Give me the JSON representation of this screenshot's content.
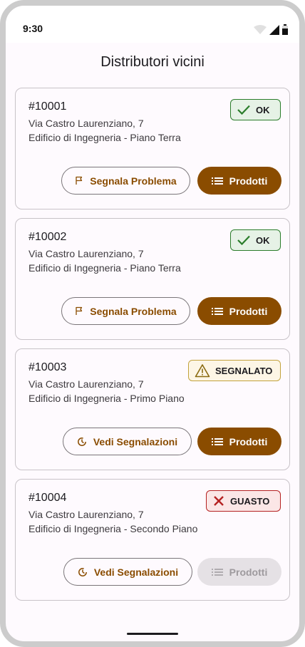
{
  "status_bar": {
    "time": "9:30"
  },
  "header": {
    "title": "Distributori vicini"
  },
  "colors": {
    "accent": "#8a4c00",
    "ok": "#2b7d2b",
    "warning": "#c2a23c",
    "error": "#b52222"
  },
  "machines": [
    {
      "id": "#10001",
      "address": "Via Castro Laurenziano, 7",
      "location": "Edificio di Ingegneria - Piano Terra",
      "status": "OK",
      "status_icon": "check-icon",
      "secondary_action": "Segnala Problema",
      "secondary_icon": "flag-icon",
      "primary_action": "Prodotti",
      "primary_icon": "list-icon",
      "primary_enabled": true
    },
    {
      "id": "#10002",
      "address": "Via Castro Laurenziano, 7",
      "location": "Edificio di Ingegneria - Piano Terra",
      "status": "OK",
      "status_icon": "check-icon",
      "secondary_action": "Segnala Problema",
      "secondary_icon": "flag-icon",
      "primary_action": "Prodotti",
      "primary_icon": "list-icon",
      "primary_enabled": true
    },
    {
      "id": "#10003",
      "address": "Via Castro Laurenziano, 7",
      "location": "Edificio di Ingegneria - Primo Piano",
      "status": "SEGNALATO",
      "status_icon": "warning-icon",
      "secondary_action": "Vedi Segnalazioni",
      "secondary_icon": "history-icon",
      "primary_action": "Prodotti",
      "primary_icon": "list-icon",
      "primary_enabled": true
    },
    {
      "id": "#10004",
      "address": "Via Castro Laurenziano, 7",
      "location": "Edificio di Ingegneria - Secondo Piano",
      "status": "GUASTO",
      "status_icon": "close-icon",
      "secondary_action": "Vedi Segnalazioni",
      "secondary_icon": "history-icon",
      "primary_action": "Prodotti",
      "primary_icon": "list-icon",
      "primary_enabled": false
    }
  ]
}
